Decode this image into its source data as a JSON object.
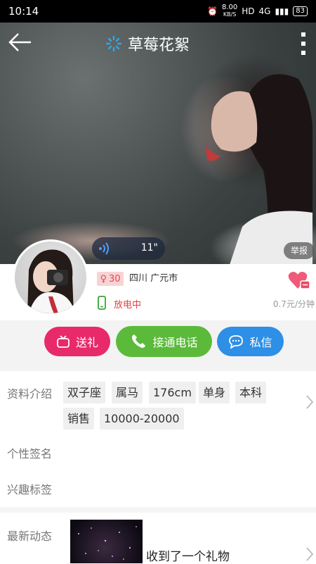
{
  "statusbar": {
    "time": "10:14",
    "net_speed_value": "8.00",
    "net_speed_unit": "KB/S",
    "hd": "HD",
    "signal": "4G",
    "battery": "83"
  },
  "header": {
    "title": "草莓花絮"
  },
  "voice": {
    "duration": "11\""
  },
  "report_label": "举报",
  "profile": {
    "age": "30",
    "location": "四川 广元市",
    "status": "放电中",
    "price": "0.7元/分钟"
  },
  "actions": {
    "gift": "送礼",
    "call": "接通电话",
    "message": "私信"
  },
  "sections": {
    "profile_intro": "资料介绍",
    "signature": "个性签名",
    "interests": "兴趣标签",
    "latest": "最新动态"
  },
  "tags": [
    "双子座",
    "属马",
    "176cm",
    "单身",
    "本科",
    "销售",
    "10000-20000"
  ],
  "moment": {
    "text": "收到了一个礼物"
  },
  "colors": {
    "gift": "#e8296a",
    "call": "#5cba3b",
    "message": "#2d8fe6",
    "status": "#e04040"
  }
}
